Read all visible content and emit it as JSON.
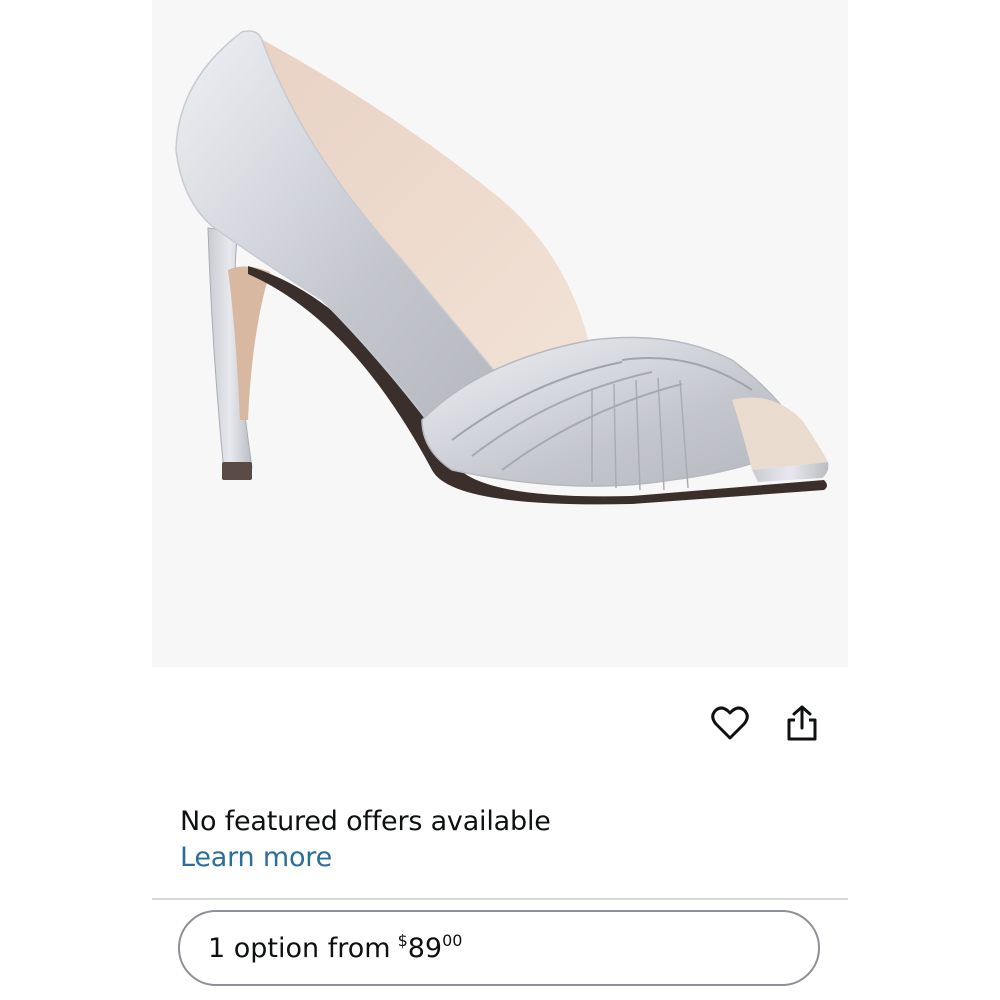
{
  "product": {
    "image_alt": "Silver satin peep-toe high heel pump"
  },
  "actions": {
    "favorite_icon": "heart-icon",
    "share_icon": "share-icon"
  },
  "offers": {
    "message": "No featured offers available",
    "learn_more": "Learn more"
  },
  "options": {
    "label": "1 option from",
    "currency": "$",
    "price_whole": "89",
    "price_fraction": "00"
  },
  "colors": {
    "link": "#2a6f9a",
    "text": "#0f1111",
    "image_bg": "#f7f7f7",
    "divider": "#d5d9d9"
  }
}
